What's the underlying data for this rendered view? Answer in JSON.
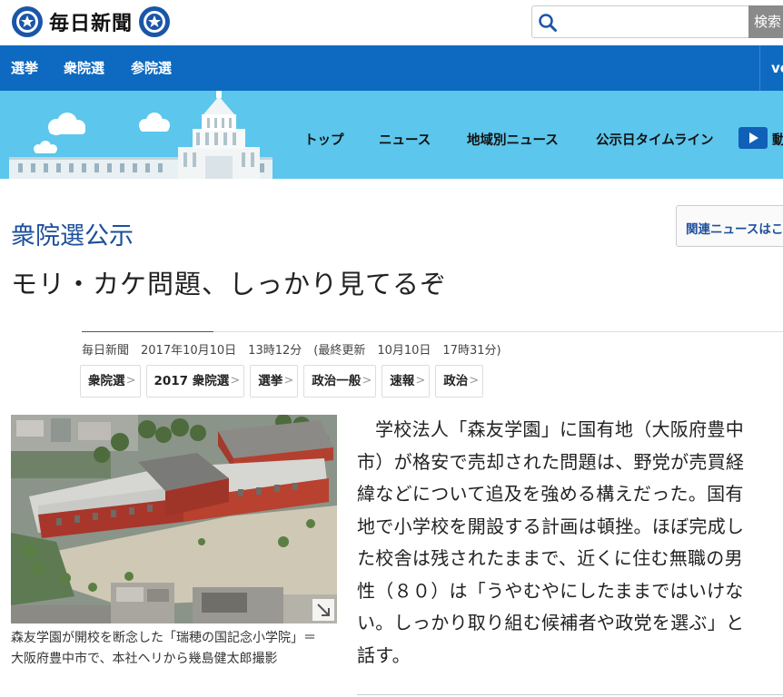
{
  "header": {
    "logo_text": "毎日新聞",
    "search_placeholder": "",
    "search_button": "検索"
  },
  "navbar": {
    "items": [
      "選挙",
      "衆院選",
      "参院選"
    ],
    "right_item": "vo"
  },
  "banner": {
    "subnav": [
      "トップ",
      "ニュース",
      "地域別ニュース",
      "公示日タイムライン"
    ],
    "video_label": "動"
  },
  "article": {
    "section_label": "衆院選公示",
    "title": "モリ・カケ問題、しっかり見てるぞ",
    "related_label": "関連ニュースはこ",
    "byline": "毎日新聞　2017年10月10日　13時12分　(最終更新　10月10日　17時31分)",
    "tags": [
      "衆院選",
      "2017 衆院選",
      "選挙",
      "政治一般",
      "速報",
      "政治"
    ],
    "caption": "森友学園が開校を断念した「瑞穂の国記念小学院」＝大阪府豊中市で、本社ヘリから幾島健太郎撮影",
    "body": "学校法人「森友学園」に国有地（大阪府豊中市）が格安で売却された問題は、野党が売買経緯などについて追及を強める構えだった。国有地で小学校を開設する計画は頓挫。ほぼ完成した校舎は残されたままで、近くに住む無職の男性（８０）は「うやむやにしたままではいけない。しっかり取り組む候補者や政党を選ぶ」と話す。"
  },
  "colors": {
    "nav_blue": "#0e6ac0",
    "banner_sky": "#5cc6ec",
    "section_blue": "#1d4f9a"
  }
}
